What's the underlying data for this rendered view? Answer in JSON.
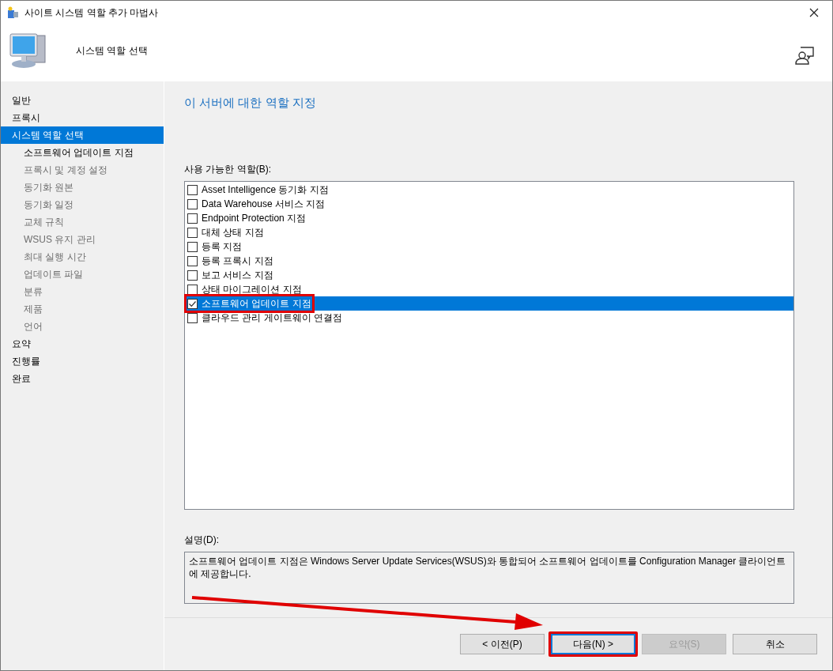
{
  "window": {
    "title": "사이트 시스템 역할 추가 마법사"
  },
  "header": {
    "title": "시스템 역할 선택"
  },
  "sidebar": {
    "items": [
      {
        "label": "일반",
        "selected": false,
        "disabled": false
      },
      {
        "label": "프록시",
        "selected": false,
        "disabled": false
      },
      {
        "label": "시스템 역할 선택",
        "selected": true,
        "disabled": false,
        "children": [
          {
            "label": "소프트웨어 업데이트 지점",
            "selected": false,
            "disabled": false
          },
          {
            "label": "프록시 및 계정 설정",
            "selected": false,
            "disabled": true
          },
          {
            "label": "동기화 원본",
            "selected": false,
            "disabled": true
          },
          {
            "label": "동기화 일정",
            "selected": false,
            "disabled": true
          },
          {
            "label": "교체 규칙",
            "selected": false,
            "disabled": true
          },
          {
            "label": "WSUS 유지 관리",
            "selected": false,
            "disabled": true
          },
          {
            "label": "최대 실행 시간",
            "selected": false,
            "disabled": true
          },
          {
            "label": "업데이트 파일",
            "selected": false,
            "disabled": true
          },
          {
            "label": "분류",
            "selected": false,
            "disabled": true
          },
          {
            "label": "제품",
            "selected": false,
            "disabled": true
          },
          {
            "label": "언어",
            "selected": false,
            "disabled": true
          }
        ]
      },
      {
        "label": "요약",
        "selected": false,
        "disabled": false
      },
      {
        "label": "진행률",
        "selected": false,
        "disabled": false
      },
      {
        "label": "완료",
        "selected": false,
        "disabled": false
      }
    ]
  },
  "content": {
    "heading": "이 서버에 대한 역할 지정",
    "roles_label": "사용 가능한 역할(B):",
    "roles": [
      {
        "label": "Asset Intelligence 동기화 지점",
        "checked": false,
        "selected": false,
        "highlighted": false
      },
      {
        "label": "Data Warehouse 서비스 지점",
        "checked": false,
        "selected": false,
        "highlighted": false
      },
      {
        "label": "Endpoint Protection 지점",
        "checked": false,
        "selected": false,
        "highlighted": false
      },
      {
        "label": "대체 상태 지점",
        "checked": false,
        "selected": false,
        "highlighted": false
      },
      {
        "label": "등록 지점",
        "checked": false,
        "selected": false,
        "highlighted": false
      },
      {
        "label": "등록 프록시 지점",
        "checked": false,
        "selected": false,
        "highlighted": false
      },
      {
        "label": "보고 서비스 지점",
        "checked": false,
        "selected": false,
        "highlighted": false
      },
      {
        "label": "상태 마이그레이션 지점",
        "checked": false,
        "selected": false,
        "highlighted": false
      },
      {
        "label": "소프트웨어 업데이트 지점",
        "checked": true,
        "selected": true,
        "highlighted": true
      },
      {
        "label": "클라우드 관리 게이트웨이 연결점",
        "checked": false,
        "selected": false,
        "highlighted": false
      }
    ],
    "description_label": "설명(D):",
    "description": "소프트웨어 업데이트 지점은 Windows Server Update Services(WSUS)와 통합되어 소프트웨어 업데이트를 Configuration Manager 클라이언트에 제공합니다."
  },
  "buttons": [
    {
      "label": "< 이전(P)",
      "disabled": false,
      "focused": false,
      "highlighted": false
    },
    {
      "label": "다음(N) >",
      "disabled": false,
      "focused": true,
      "highlighted": true
    },
    {
      "label": "요약(S)",
      "disabled": true,
      "focused": false,
      "highlighted": false
    },
    {
      "label": "취소",
      "disabled": false,
      "focused": false,
      "highlighted": false
    }
  ]
}
